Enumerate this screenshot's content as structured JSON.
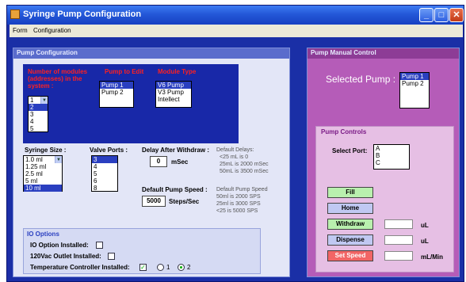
{
  "window": {
    "title": "Syringe Pump Configuration",
    "min": "_",
    "max": "□",
    "close": "✕"
  },
  "menu": {
    "items": [
      "Form",
      "Configuration"
    ]
  },
  "config": {
    "title": "Pump Configuration",
    "modules_label": "Number of modules (addresses) in the system :",
    "modules": {
      "items": [
        "1",
        "2",
        "3",
        "4",
        "5"
      ],
      "selected": 1
    },
    "edit_label": "Pump to Edit",
    "edit_pumps": {
      "items": [
        "Pump 1",
        "Pump 2"
      ],
      "selected": 0
    },
    "type_label": "Module Type",
    "types": {
      "items": [
        "V6 Pump",
        "V3 Pump",
        "Intellect"
      ],
      "selected": 0
    },
    "syringe_label": "Syringe Size :",
    "syringes": {
      "items": [
        "1.0 ml",
        "1.25 ml",
        "2.5 ml",
        "5 ml",
        "10 ml"
      ],
      "selected": 4
    },
    "valve_label": "Valve Ports :",
    "valves": {
      "items": [
        "3",
        "4",
        "5",
        "6",
        "8"
      ],
      "selected": 0
    },
    "delay_label": "Delay After Withdraw :",
    "delay_value": "0",
    "delay_unit": "mSec",
    "delay_help": [
      "Default Delays:",
      "<25 mL is 0",
      "25mL is 2000 mSec",
      "50mL is 3500 mSec"
    ],
    "speed_label": "Default Pump Speed :",
    "speed_value": "5000",
    "speed_unit": "Steps/Sec",
    "speed_help": [
      "Default Pump Speed",
      "50ml is 2000 SPS",
      "25ml is 3000 SPS",
      "<25 is 5000 SPS"
    ],
    "io": {
      "title": "IO Options",
      "option_label": "IO Option Installed:",
      "outlet_label": "120Vac Outlet Installed:",
      "temp_label": "Temperature Controller Installed:",
      "temp_checked": "✓",
      "radio1": "1",
      "radio2": "2"
    }
  },
  "manual": {
    "title": "Pump Manual Control",
    "selected_label": "Selected Pump :",
    "pumps": {
      "items": [
        "Pump 1",
        "Pump 2"
      ],
      "selected": 0
    },
    "controls_title": "Pump Controls",
    "port_label": "Select Port:",
    "ports": [
      "A",
      "B",
      "C"
    ],
    "fill": "Fill",
    "home": "Home",
    "withdraw": "Withdraw",
    "dispense": "Dispense",
    "set_speed": "Set Speed",
    "unit_ul": "uL",
    "unit_ulmin": "mL/Min"
  },
  "colors": {
    "accent_red": "#ff2020",
    "panel_blue": "#1828a8",
    "manual_purple": "#b55cb8"
  }
}
